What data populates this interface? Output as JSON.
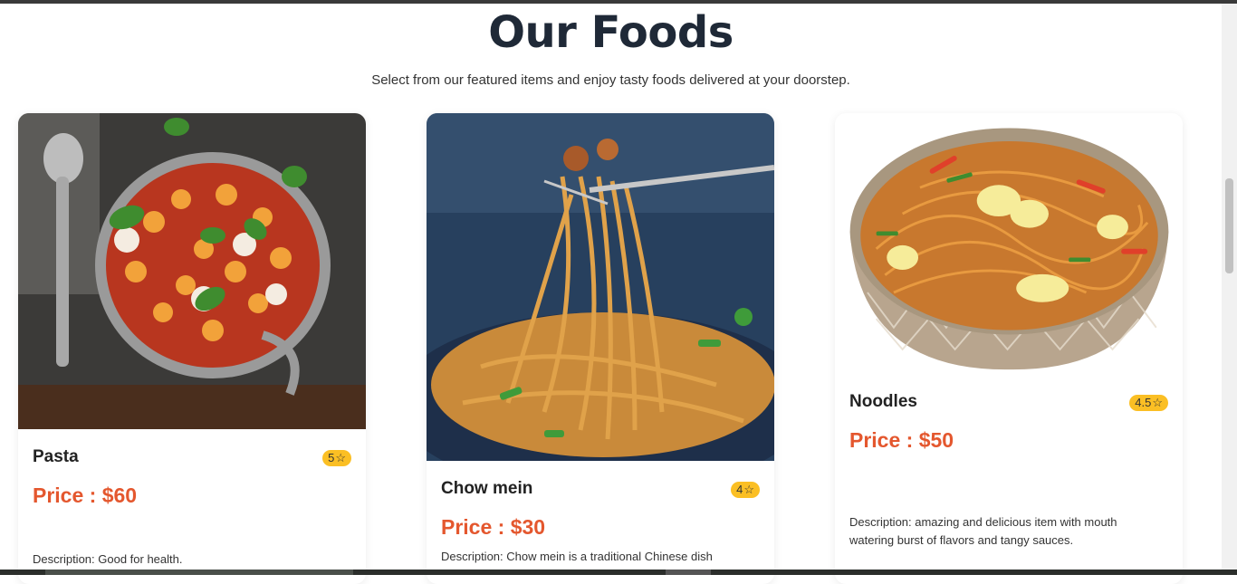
{
  "section": {
    "title": "Our Foods",
    "subtitle": "Select from our featured items and enjoy tasty foods delivered at your doorstep."
  },
  "cards": [
    {
      "name": "Pasta",
      "rating": "5",
      "price": "Price : $60",
      "description": "Description: Good for health.",
      "image": "pasta-image"
    },
    {
      "name": "Chow mein",
      "rating": "4",
      "price": "Price : $30",
      "description": "Description: Chow mein is a traditional Chinese dish",
      "image": "chow-mein-image"
    },
    {
      "name": "Noodles",
      "rating": "4.5",
      "price": "Price : $50",
      "description": "Description: amazing and delicious item with mouth watering burst of flavors and tangy sauces.",
      "image": "noodles-image"
    }
  ],
  "colors": {
    "accent": "#e4572e",
    "badge": "#fbbf24",
    "title": "#1f2937"
  }
}
